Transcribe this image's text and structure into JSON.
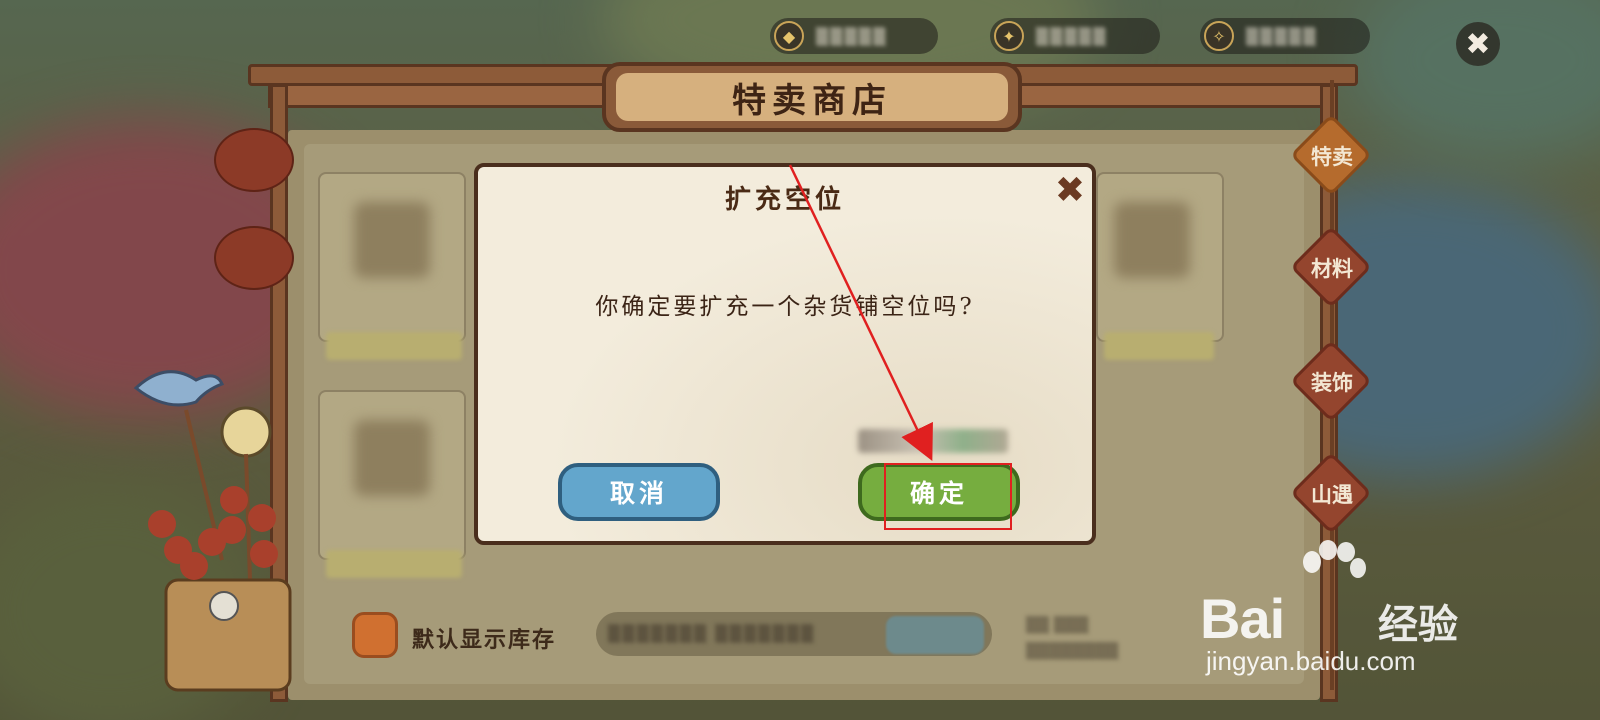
{
  "shop": {
    "title": "特卖商店",
    "tabs": [
      {
        "label": "特卖",
        "active": true
      },
      {
        "label": "材料",
        "active": false
      },
      {
        "label": "装饰",
        "active": false
      },
      {
        "label": "山遇",
        "active": false
      }
    ],
    "stock_toggle_label": "默认显示库存"
  },
  "dialog": {
    "title": "扩充空位",
    "message": "你确定要扩充一个杂货铺空位吗?",
    "close_glyph": "✖",
    "cancel_label": "取消",
    "confirm_label": "确定"
  },
  "topbar": {
    "close_glyph": "✖"
  },
  "watermark": {
    "brand": "Bai",
    "brand_suffix": "经验",
    "url": "jingyan.baidu.com"
  },
  "colors": {
    "confirm_button": "#76ad3f",
    "cancel_button": "#63a6cc",
    "annotation": "#e02020",
    "frame_wood": "#8d5b39"
  }
}
